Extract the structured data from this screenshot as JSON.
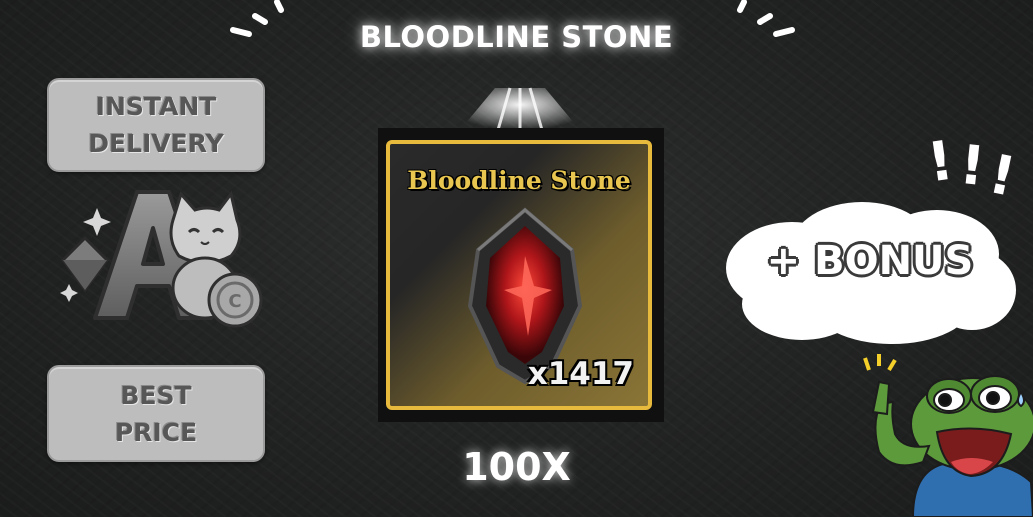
{
  "title": "BLOODLINE STONE",
  "badges": {
    "instant": [
      "INSTANT",
      "DELIVERY"
    ],
    "price": [
      "BEST",
      "PRICE"
    ]
  },
  "logo": {
    "icon": "letter-a-cat-coin-logo"
  },
  "card": {
    "title": "Bloodline Stone",
    "quantity": "x1417",
    "border_color": "#e7b93c"
  },
  "multiplier": "100X",
  "bonus": {
    "text": "+ BONUS",
    "exclaim": [
      "!",
      "!",
      "!"
    ]
  },
  "mascot": {
    "icon": "pointing-frog-icon"
  }
}
